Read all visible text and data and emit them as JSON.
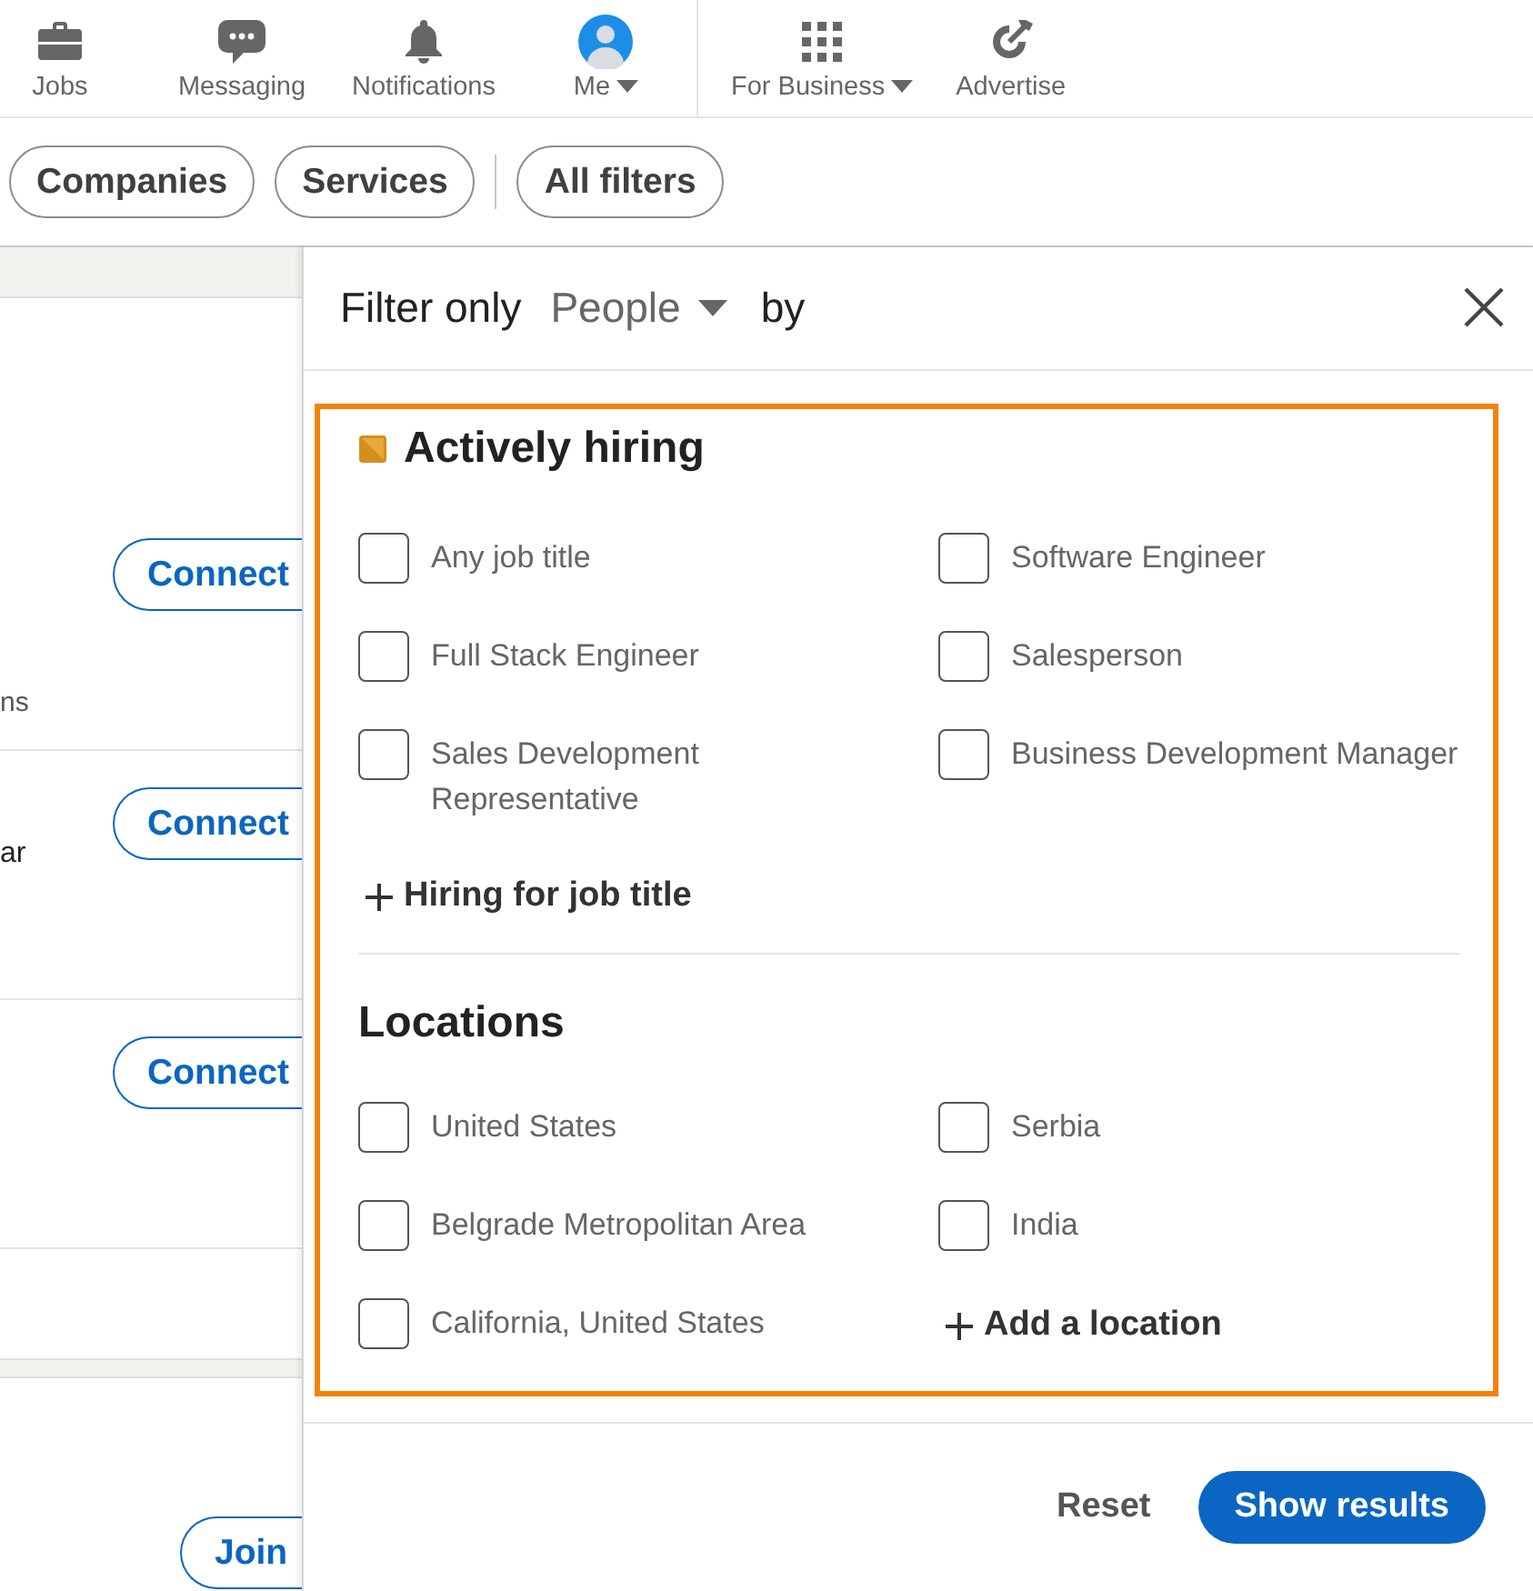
{
  "nav": {
    "items": [
      {
        "label": "Jobs",
        "has_menu": false
      },
      {
        "label": "Messaging",
        "has_menu": false
      },
      {
        "label": "Notifications",
        "has_menu": false
      },
      {
        "label": "Me",
        "has_menu": true
      }
    ],
    "business_items": [
      {
        "label": "For Business",
        "has_menu": true
      },
      {
        "label": "Advertise",
        "has_menu": false
      }
    ]
  },
  "filter_bar": {
    "pills": [
      "Companies",
      "Services"
    ],
    "all_filters": "All filters"
  },
  "results": [
    {
      "button": "Connect",
      "text": "ns"
    },
    {
      "button": "Connect",
      "text": "ar"
    },
    {
      "button": "Connect"
    }
  ],
  "group": {
    "button": "Join"
  },
  "filter_panel": {
    "title_prefix": "Filter only",
    "type": "People",
    "title_suffix": "by",
    "sections": [
      {
        "title": "Actively hiring",
        "options": [
          {
            "label": "Any job title",
            "checked": false
          },
          {
            "label": "Software Engineer",
            "checked": false
          },
          {
            "label": "Full Stack Engineer",
            "checked": false
          },
          {
            "label": "Salesperson",
            "checked": false
          },
          {
            "label": "Sales Development Representative",
            "checked": false
          },
          {
            "label": "Business Development Manager",
            "checked": false
          }
        ],
        "add": "Hiring for job title"
      },
      {
        "title": "Locations",
        "options": [
          {
            "label": "United States",
            "checked": false
          },
          {
            "label": "Serbia",
            "checked": false
          },
          {
            "label": "Belgrade Metropolitan Area",
            "checked": false
          },
          {
            "label": "India",
            "checked": false
          },
          {
            "label": "California, United States",
            "checked": false
          }
        ],
        "add": "Add a location"
      }
    ],
    "reset": "Reset",
    "apply": "Show results"
  }
}
